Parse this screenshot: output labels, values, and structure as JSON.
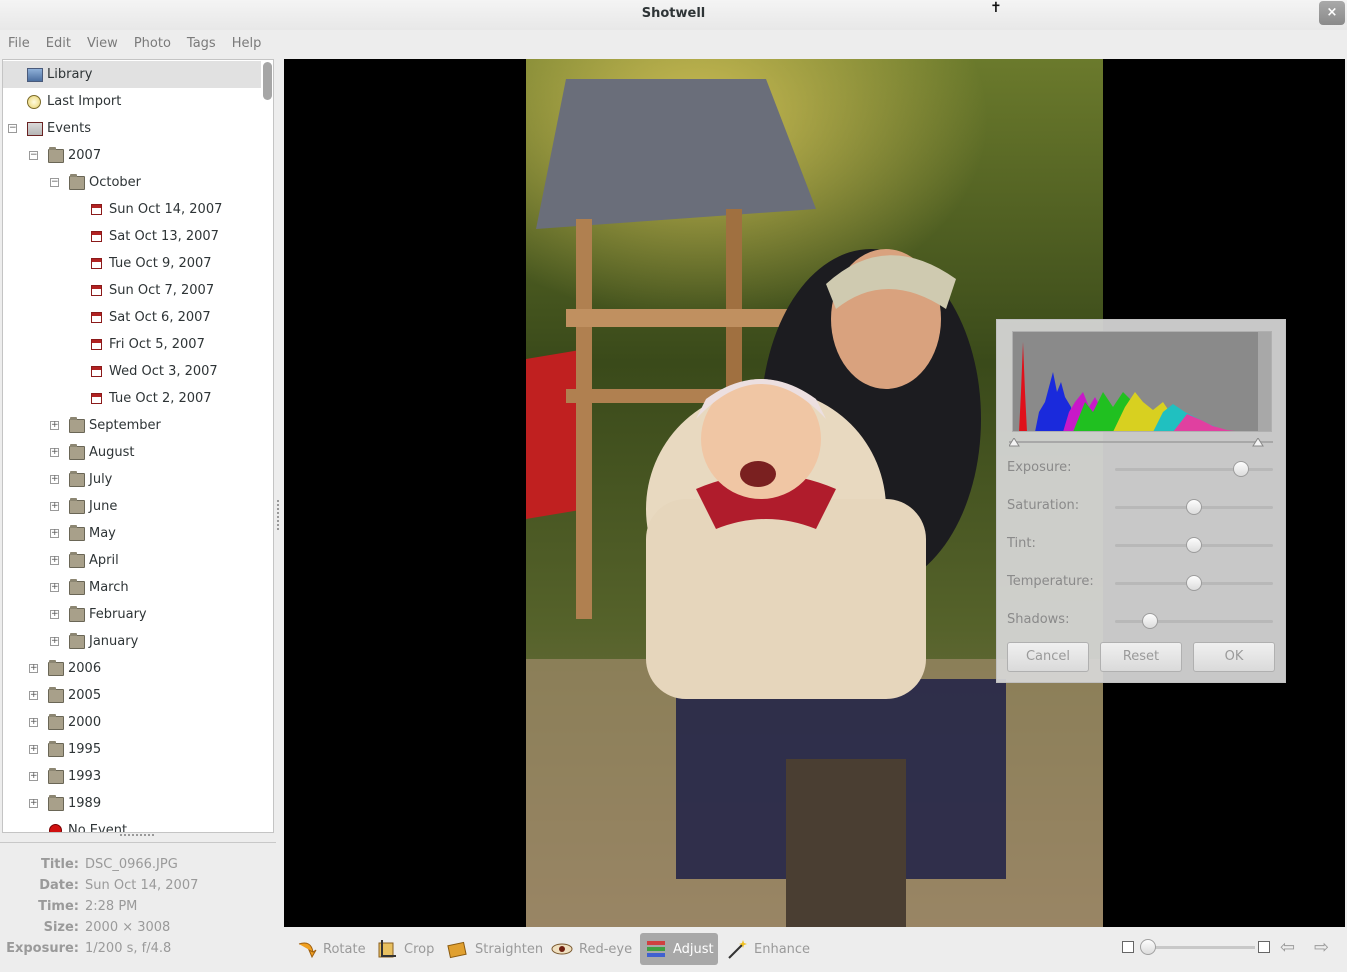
{
  "window": {
    "title": "Shotwell",
    "close_glyph": "×"
  },
  "menubar": [
    "File",
    "Edit",
    "View",
    "Photo",
    "Tags",
    "Help"
  ],
  "sidebar": {
    "library": "Library",
    "last_import": "Last Import",
    "events": "Events",
    "year_2007": "2007",
    "october": "October",
    "october_days": [
      "Sun Oct 14, 2007",
      "Sat Oct 13, 2007",
      "Tue Oct 9, 2007",
      "Sun Oct 7, 2007",
      "Sat Oct 6, 2007",
      "Fri Oct 5, 2007",
      "Wed Oct 3, 2007",
      "Tue Oct 2, 2007"
    ],
    "months_2007": [
      "September",
      "August",
      "July",
      "June",
      "May",
      "April",
      "March",
      "February",
      "January"
    ],
    "years": [
      "2006",
      "2005",
      "2000",
      "1995",
      "1993",
      "1989"
    ],
    "no_event": "No Event"
  },
  "info": {
    "title_key": "Title:",
    "title_val": "DSC_0966.JPG",
    "date_key": "Date:",
    "date_val": "Sun Oct 14, 2007",
    "time_key": "Time:",
    "time_val": "2:28 PM",
    "size_key": "Size:",
    "size_val": "2000 × 3008",
    "exposure_key": "Exposure:",
    "exposure_val": "1/200 s, f/4.8"
  },
  "adjust": {
    "sliders": [
      {
        "label": "Exposure:",
        "value": 0.8
      },
      {
        "label": "Saturation:",
        "value": 0.5
      },
      {
        "label": "Tint:",
        "value": 0.5
      },
      {
        "label": "Temperature:",
        "value": 0.5
      },
      {
        "label": "Shadows:",
        "value": 0.22
      }
    ],
    "cancel": "Cancel",
    "reset": "Reset",
    "ok": "OK"
  },
  "toolbar": {
    "rotate": "Rotate",
    "crop": "Crop",
    "straighten": "Straighten",
    "redeye": "Red-eye",
    "adjust": "Adjust",
    "enhance": "Enhance",
    "zoom_level": 0.0
  },
  "colors": {
    "accent_selected": "#e1e1e1",
    "active_tool": "#a8a8a8"
  }
}
